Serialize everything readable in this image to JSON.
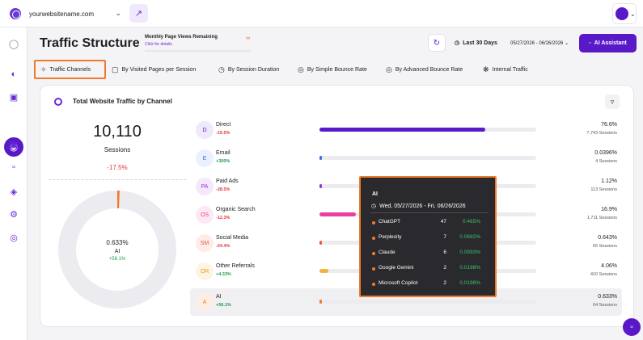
{
  "topbar": {
    "site": "yourwebsitename.com",
    "site_icon": "globe-icon",
    "external_icon": "external-link-icon"
  },
  "header": {
    "title": "Traffic Structure",
    "monthly_label": "Monthly Page Views Remaining",
    "monthly_link": "Click for details",
    "monthly_value": "∞",
    "period": "Last 30 Days",
    "date_range": "05/27/2026 - 06/26/2026",
    "ai_button": "AI Assistant"
  },
  "tabs": [
    {
      "label": "Traffic Channels",
      "icon": "channels-icon"
    },
    {
      "label": "By Visited Pages per Session",
      "icon": "pages-icon"
    },
    {
      "label": "By Session Duration",
      "icon": "clock-icon"
    },
    {
      "label": "By Simple Bounce Rate",
      "icon": "bounce-icon"
    },
    {
      "label": "By Advanced Bounce Rate",
      "icon": "advanced-bounce-icon"
    },
    {
      "label": "Internal Traffic",
      "icon": "internal-icon"
    }
  ],
  "card": {
    "title": "Total Website Traffic by Channel",
    "sessions_total": "10,110",
    "sessions_label": "Sessions",
    "sessions_change": "-17.5%",
    "donut": {
      "pct": "0.633%",
      "name": "AI",
      "change": "+56.1%",
      "fraction": 0.00633
    }
  },
  "channels": [
    {
      "badge": "D",
      "name": "Direct",
      "change": "-19.5%",
      "pct": "76.6%",
      "sessions": "7,743 Sessions",
      "fraction": 0.766,
      "color": "#5a19c9",
      "badge_bg": "#efe9fb",
      "badge_fg": "#5a19c9"
    },
    {
      "badge": "E",
      "name": "Email",
      "change": "+300%",
      "pct": "0.0396%",
      "sessions": "4 Sessions",
      "fraction": 0.0004,
      "color": "#3b6ce6",
      "badge_bg": "#eaf0fd",
      "badge_fg": "#3b6ce6"
    },
    {
      "badge": "PA",
      "name": "Paid Ads",
      "change": "-28.5%",
      "pct": "1.12%",
      "sessions": "113 Sessions",
      "fraction": 0.0112,
      "color": "#9a2fd6",
      "badge_bg": "#f4e9fb",
      "badge_fg": "#9a2fd6"
    },
    {
      "badge": "OS",
      "name": "Organic Search",
      "change": "-12.3%",
      "pct": "16.9%",
      "sessions": "1,711 Sessions",
      "fraction": 0.169,
      "color": "#e83fa0",
      "badge_bg": "#fde9f3",
      "badge_fg": "#e83fa0"
    },
    {
      "badge": "SM",
      "name": "Social Media",
      "change": "-24.4%",
      "pct": "0.643%",
      "sessions": "65 Sessions",
      "fraction": 0.00643,
      "color": "#e85a3a",
      "badge_bg": "#fdece8",
      "badge_fg": "#e85a3a"
    },
    {
      "badge": "OR",
      "name": "Other Referrals",
      "change": "+4.33%",
      "pct": "4.06%",
      "sessions": "410 Sessions",
      "fraction": 0.0406,
      "color": "#f2b43a",
      "badge_bg": "#fdf5e4",
      "badge_fg": "#e0a020"
    },
    {
      "badge": "A",
      "name": "AI",
      "change": "+56.1%",
      "pct": "0.633%",
      "sessions": "64 Sessions",
      "fraction": 0.00633,
      "color": "#f07a2b",
      "badge_bg": "#fdeee4",
      "badge_fg": "#f07a2b"
    }
  ],
  "tooltip": {
    "title": "AI",
    "date": "Wed, 05/27/2026 - Fri, 06/26/2026",
    "rows": [
      {
        "name": "ChatGPT",
        "value": "47",
        "pct": "0.465%"
      },
      {
        "name": "Perplexity",
        "value": "7",
        "pct": "0.0692%"
      },
      {
        "name": "Claude",
        "value": "6",
        "pct": "0.0593%"
      },
      {
        "name": "Google Gemini",
        "value": "2",
        "pct": "0.0198%"
      },
      {
        "name": "Microsoft Copilot",
        "value": "2",
        "pct": "0.0198%"
      }
    ]
  },
  "colors": {
    "accent": "#5a19c9",
    "highlight": "#f07a2b"
  }
}
